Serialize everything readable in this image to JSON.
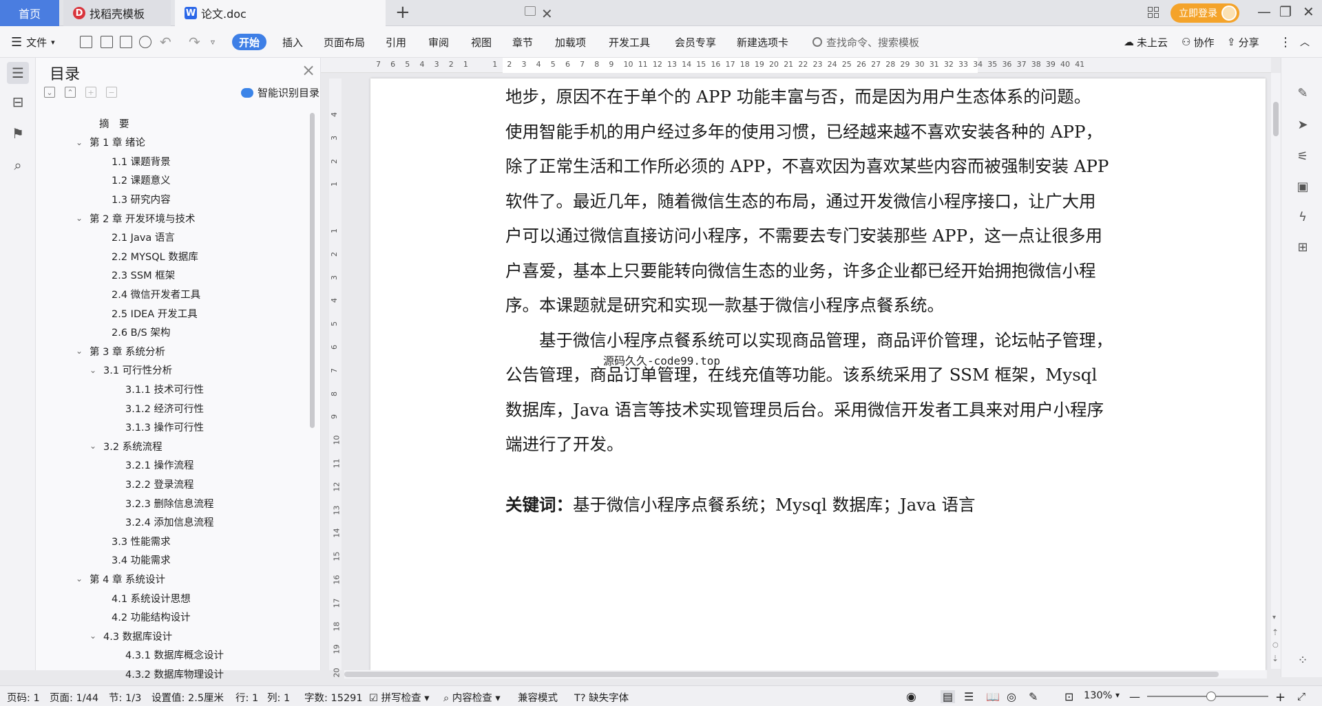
{
  "tabs": {
    "home": "首页",
    "templates": "找稻壳模板",
    "doc": "论文.doc"
  },
  "header": {
    "login": "立即登录"
  },
  "menu": {
    "file": "文件",
    "start": "开始",
    "insert": "插入",
    "layout": "页面布局",
    "reference": "引用",
    "review": "审阅",
    "view": "视图",
    "chapter": "章节",
    "addins": "加载项",
    "devtools": "开发工具",
    "member": "会员专享",
    "newtab": "新建选项卡",
    "search_placeholder": "查找命令、搜索模板",
    "cloud": "未上云",
    "collab": "协作",
    "share": "分享"
  },
  "toc": {
    "title": "目录",
    "smart": "智能识别目录",
    "items": [
      "摘　要",
      "第 1 章  绪论",
      "1.1  课题背景",
      "1.2  课题意义",
      "1.3  研究内容",
      "第 2 章  开发环境与技术",
      "2.1 Java 语言",
      "2.2 MYSQL 数据库",
      "2.3 SSM 框架",
      "2.4 微信开发者工具",
      "2.5 IDEA 开发工具",
      "2.6 B/S 架构",
      "第 3 章  系统分析",
      "3.1  可行性分析",
      "3.1.1  技术可行性",
      "3.1.2  经济可行性",
      "3.1.3  操作可行性",
      "3.2  系统流程",
      "3.2.1  操作流程",
      "3.2.2  登录流程",
      "3.2.3  删除信息流程",
      "3.2.4  添加信息流程",
      "3.3  性能需求",
      "3.4  功能需求",
      "第 4 章  系统设计",
      "4.1  系统设计思想",
      "4.2  功能结构设计",
      "4.3  数据库设计",
      "4.3.1  数据库概念设计",
      "4.3.2  数据库物理设计"
    ]
  },
  "document": {
    "lines": [
      "地步，原因不在于单个的 APP 功能丰富与否，而是因为用户生态体系的问题。",
      "使用智能手机的用户经过多年的使用习惯，已经越来越不喜欢安装各种的 APP，",
      "除了正常生活和工作所必须的 APP，不喜欢因为喜欢某些内容而被强制安装 APP",
      "软件了。最近几年，随着微信生态的布局，通过开发微信小程序接口，让广大用",
      "户可以通过微信直接访问小程序，不需要去专门安装那些 APP，这一点让很多用",
      "户喜爱，基本上只要能转向微信生态的业务，许多企业都已经开始拥抱微信小程",
      "序。本课题就是研究和实现一款基于微信小程序点餐系统。",
      "　　基于微信小程序点餐系统可以实现商品管理，商品评价管理，论坛帖子管理，",
      "公告管理，商品订单管理，在线充值等功能。该系统采用了 SSM 框架，Mysql",
      "数据库，Java 语言等技术实现管理员后台。采用微信开发者工具来对用户小程序",
      "端进行了开发。"
    ],
    "watermark": "源码久久-code99.top",
    "keywords_label": "关键词：",
    "keywords_text": "基于微信小程序点餐系统；Mysql 数据库；Java 语言"
  },
  "ruler": {
    "top": [
      "7",
      "6",
      "5",
      "4",
      "3",
      "2",
      "1",
      "",
      "1",
      "2",
      "3",
      "4",
      "5",
      "6",
      "7",
      "8",
      "9",
      "10",
      "11",
      "12",
      "13",
      "14",
      "15",
      "16",
      "17",
      "18",
      "19",
      "20",
      "21",
      "22",
      "23",
      "24",
      "25",
      "26",
      "27",
      "28",
      "29",
      "30",
      "31",
      "32",
      "33",
      "34",
      "35",
      "36",
      "37",
      "38",
      "39",
      "40",
      "41"
    ],
    "left": [
      "4",
      "3",
      "2",
      "1",
      "",
      "1",
      "2",
      "3",
      "4",
      "5",
      "6",
      "7",
      "8",
      "9",
      "10",
      "11",
      "12",
      "13",
      "14",
      "15",
      "16",
      "17",
      "18",
      "19",
      "20"
    ]
  },
  "status": {
    "page_no": "页码: 1",
    "pages": "页面: 1/44",
    "section": "节: 1/3",
    "setting": "设置值: 2.5厘米",
    "row": "行: 1",
    "col": "列: 1",
    "words": "字数: 15291",
    "spell": "拼写检查",
    "content": "内容检查",
    "compat": "兼容模式",
    "fonts": "缺失字体",
    "zoom": "130%"
  }
}
